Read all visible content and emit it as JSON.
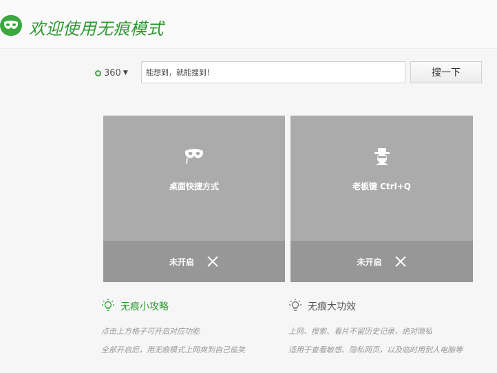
{
  "header": {
    "title": "欢迎使用无痕模式",
    "logo_icon": "incognito-mask-icon",
    "accent_color": "#3aa83e"
  },
  "search": {
    "engine_label": "360",
    "engine_icon": "360-ring-icon",
    "input_value": "能想到，就能搜到！",
    "button_label": "搜一下"
  },
  "tiles": [
    {
      "icon": "mask-icon",
      "label": "桌面快捷方式",
      "status": "未开启",
      "toggle_icon": "close-icon"
    },
    {
      "icon": "boss-key-icon",
      "label": "老板键 Ctrl+Q",
      "status": "未开启",
      "toggle_icon": "close-icon"
    }
  ],
  "tips": [
    {
      "icon": "lightbulb-icon",
      "title": "无痕小攻略",
      "lines": [
        "点击上方格子可开启对应功能",
        "全部开启后，用无痕模式上网爽到自己偷笑"
      ]
    },
    {
      "icon": "lightbulb-icon",
      "title": "无痕大功效",
      "lines": [
        "上网、搜索、看片不留历史记录，绝对隐私",
        "适用于查看敏感、隐私网页，以及临时用别人电脑等"
      ]
    }
  ]
}
